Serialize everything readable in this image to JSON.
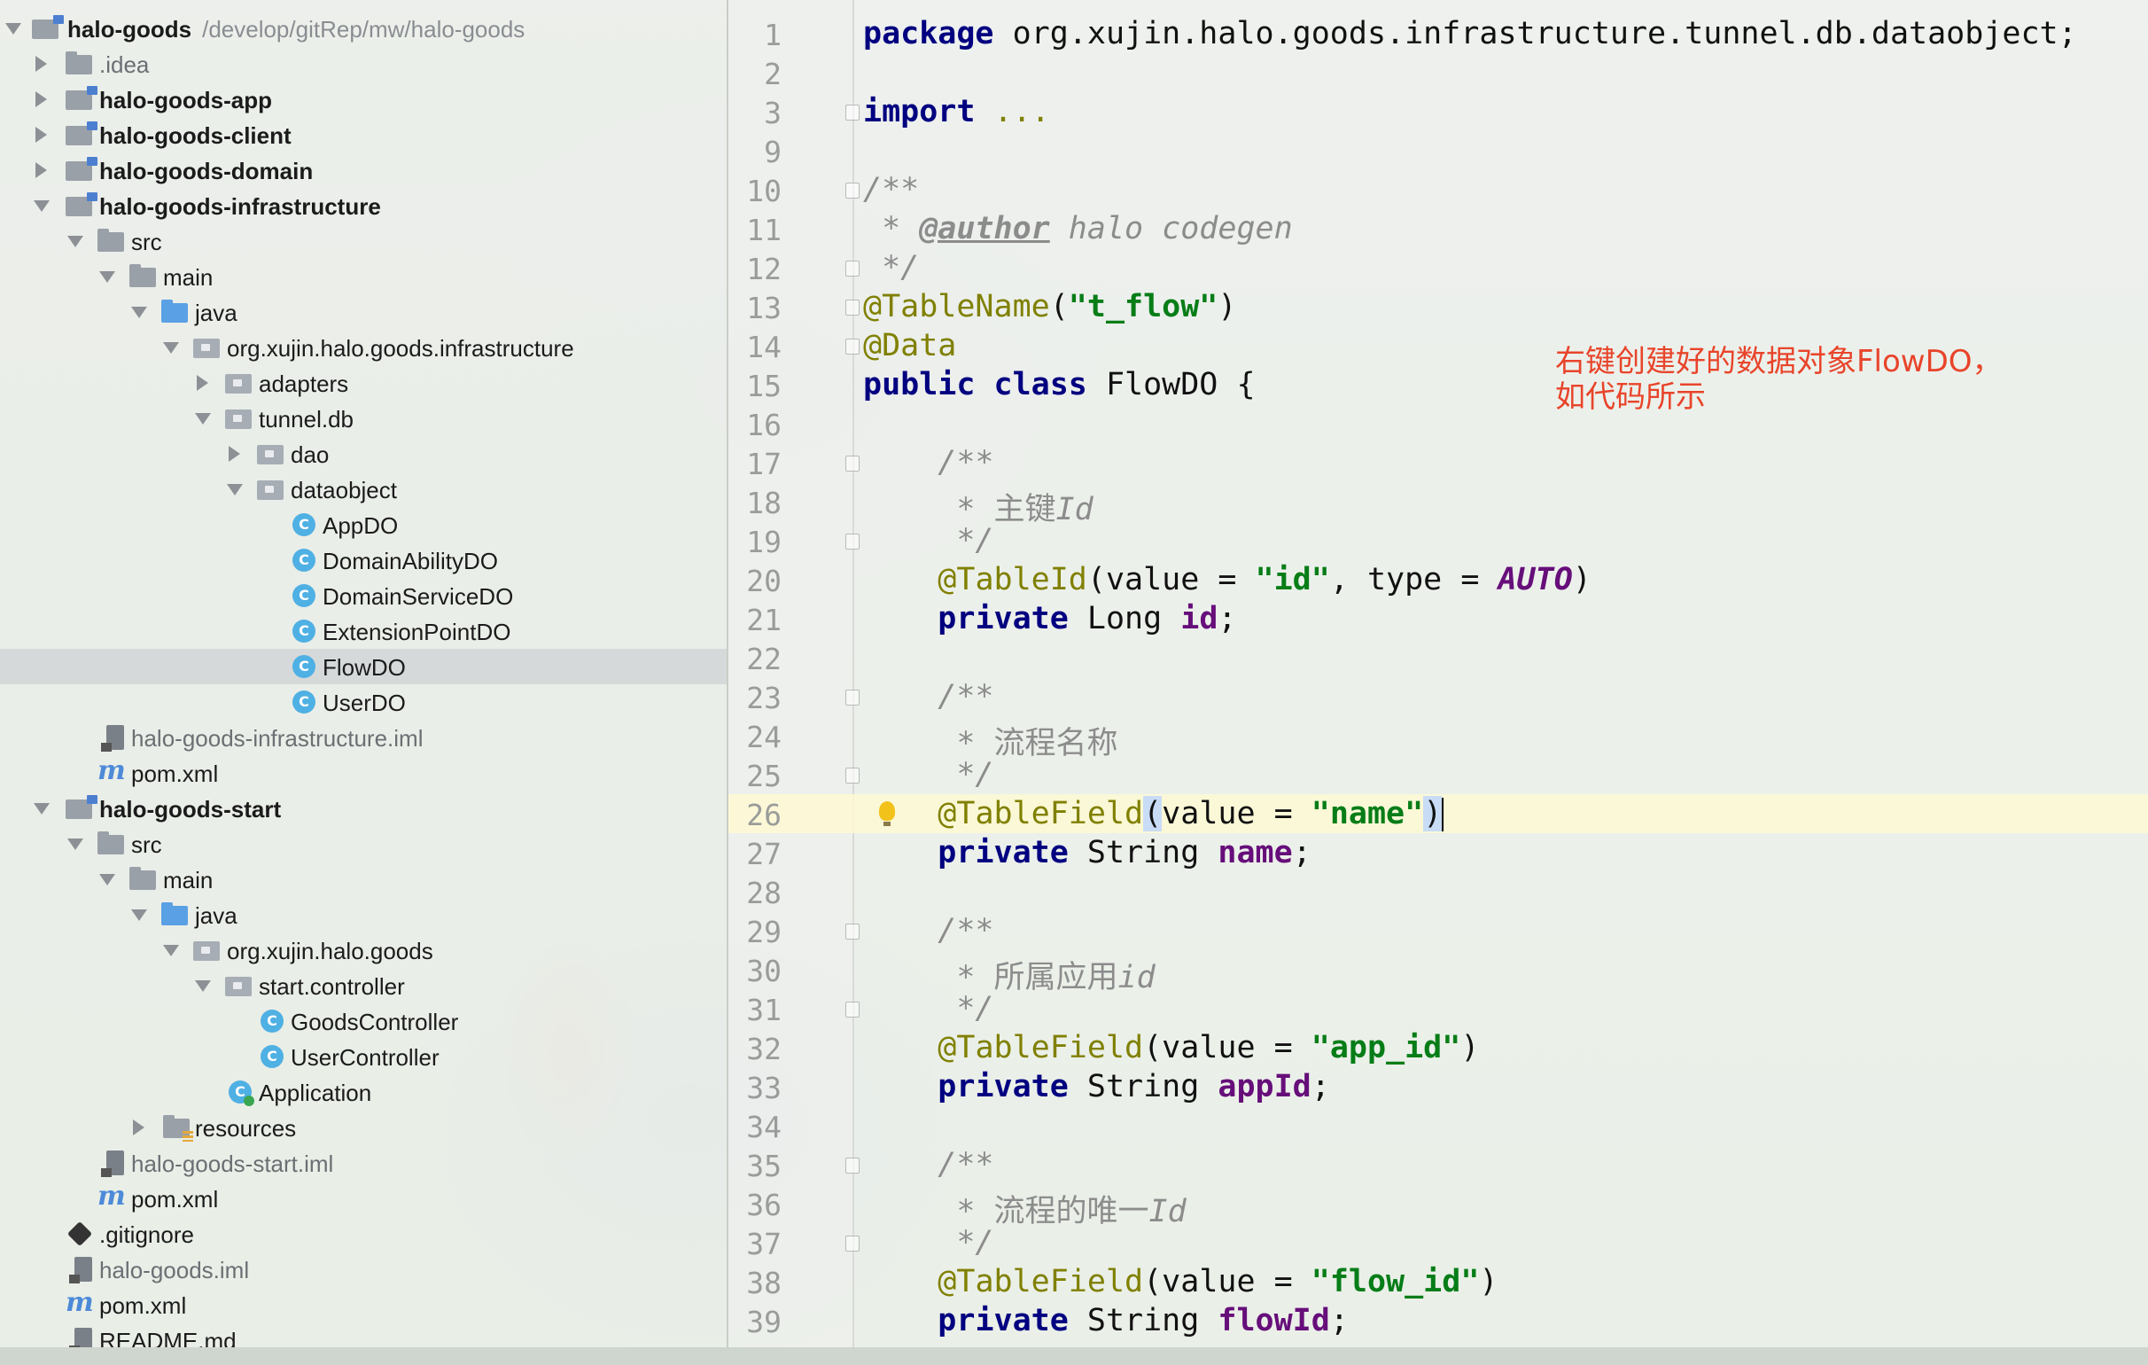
{
  "project": {
    "root": {
      "name": "halo-goods",
      "path": "/develop/gitRep/mw/halo-goods"
    },
    "items": [
      {
        "label": ".idea"
      },
      {
        "label": "halo-goods-app"
      },
      {
        "label": "halo-goods-client"
      },
      {
        "label": "halo-goods-domain"
      },
      {
        "label": "halo-goods-infrastructure"
      },
      {
        "label": "src"
      },
      {
        "label": "main"
      },
      {
        "label": "java"
      },
      {
        "label": "org.xujin.halo.goods.infrastructure"
      },
      {
        "label": "adapters"
      },
      {
        "label": "tunnel.db"
      },
      {
        "label": "dao"
      },
      {
        "label": "dataobject"
      },
      {
        "label": "AppDO"
      },
      {
        "label": "DomainAbilityDO"
      },
      {
        "label": "DomainServiceDO"
      },
      {
        "label": "ExtensionPointDO"
      },
      {
        "label": "FlowDO"
      },
      {
        "label": "UserDO"
      },
      {
        "label": "halo-goods-infrastructure.iml"
      },
      {
        "label": "pom.xml"
      },
      {
        "label": "halo-goods-start"
      },
      {
        "label": "src"
      },
      {
        "label": "main"
      },
      {
        "label": "java"
      },
      {
        "label": "org.xujin.halo.goods"
      },
      {
        "label": "start.controller"
      },
      {
        "label": "GoodsController"
      },
      {
        "label": "UserController"
      },
      {
        "label": "Application"
      },
      {
        "label": "resources"
      },
      {
        "label": "halo-goods-start.iml"
      },
      {
        "label": "pom.xml"
      },
      {
        "label": ".gitignore"
      },
      {
        "label": "halo-goods.iml"
      },
      {
        "label": "pom.xml"
      },
      {
        "label": "README.md"
      }
    ],
    "class_icon_letter": "C",
    "maven_icon_letter": "m"
  },
  "editor": {
    "line_numbers": [
      "1",
      "2",
      "3",
      "9",
      "10",
      "11",
      "12",
      "13",
      "14",
      "15",
      "16",
      "17",
      "18",
      "19",
      "20",
      "21",
      "22",
      "23",
      "24",
      "25",
      "26",
      "27",
      "28",
      "29",
      "30",
      "31",
      "32",
      "33",
      "34",
      "35",
      "36",
      "37",
      "38",
      "39"
    ],
    "tokens": {
      "package_kw": "package",
      "package_name": " org.xujin.halo.goods.infrastructure.tunnel.db.dataobject;",
      "import_kw": "import",
      "import_fold": " ...",
      "doc_open": "/**",
      "author_prefix": " * ",
      "author_tag": "@author",
      "author_value": " halo codegen",
      "doc_close": " */",
      "ann_tablename": "@TableName",
      "tablename_open": "(",
      "tablename_value": "\"t_flow\"",
      "tablename_close": ")",
      "ann_data": "@Data",
      "public_class_kw": "public class",
      "class_name": " FlowDO {",
      "indent": "    ",
      "doc_open_indented": "    /**",
      "star_prefix": "     * ",
      "doc_close_indented": "     */",
      "comment_id_text": "主键",
      "comment_id_tail": "Id",
      "ann_tableid": "@TableId",
      "tableid_args_a": "(value = ",
      "tableid_value": "\"id\"",
      "tableid_args_b": ", type = ",
      "tableid_type": "AUTO",
      "paren_close": ")",
      "private_kw": "private",
      "type_long": " Long ",
      "field_id": "id",
      "semicolon": ";",
      "comment_name": "流程名称",
      "ann_tablefield": "@TableField",
      "paren_open": "(",
      "value_eq": "value = ",
      "name_value": "\"name\"",
      "type_string": " String ",
      "field_name": "name",
      "comment_app_text": "所属应用",
      "comment_app_tail": "id",
      "app_id_value": "\"app_id\"",
      "field_appid": "appId",
      "comment_flow_text": "流程的唯一",
      "comment_flow_tail": "Id",
      "flow_id_value": "\"flow_id\"",
      "field_flowid": "flowId"
    }
  },
  "annotation": {
    "text_line1": "右键创建好的数据对象FlowDO，",
    "text_line2": "如代码所示",
    "color": "#e8442a"
  },
  "colors": {
    "keyword": "#000080",
    "string": "#067d17",
    "annotation": "#808000",
    "comment": "#8c8c8c",
    "field": "#660e7a",
    "class_icon": "#4fb0e4"
  }
}
